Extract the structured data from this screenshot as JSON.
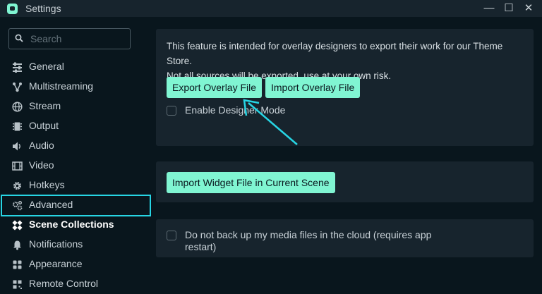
{
  "window": {
    "title": "Settings",
    "minimize": "—",
    "maximize": "☐",
    "close": "✕"
  },
  "search": {
    "placeholder": "Search"
  },
  "sidebar": {
    "items": [
      {
        "label": "General",
        "icon": "sliders-icon"
      },
      {
        "label": "Multistreaming",
        "icon": "network-icon"
      },
      {
        "label": "Stream",
        "icon": "globe-icon"
      },
      {
        "label": "Output",
        "icon": "chip-icon"
      },
      {
        "label": "Audio",
        "icon": "speaker-icon"
      },
      {
        "label": "Video",
        "icon": "film-icon"
      },
      {
        "label": "Hotkeys",
        "icon": "gear-icon"
      },
      {
        "label": "Advanced",
        "icon": "gears-icon"
      },
      {
        "label": "Scene Collections",
        "icon": "puzzle-icon",
        "active": true
      },
      {
        "label": "Notifications",
        "icon": "bell-icon"
      },
      {
        "label": "Appearance",
        "icon": "palette-icon"
      },
      {
        "label": "Remote Control",
        "icon": "remote-icon"
      }
    ]
  },
  "overlay_section": {
    "description_line1": "This feature is intended for overlay designers to export their work for our Theme Store.",
    "description_line2": "Not all sources will be exported, use at your own risk.",
    "export_button": "Export Overlay File",
    "import_button": "Import Overlay File",
    "designer_mode_label": "Enable Designer Mode",
    "designer_mode_checked": false
  },
  "widget_section": {
    "import_widget_button": "Import Widget File in Current Scene"
  },
  "backup_section": {
    "label_line1": "Do not back up my media files in the cloud (requires app",
    "label_line2": "restart)",
    "checked": false
  },
  "colors": {
    "accent": "#80f5d2",
    "highlight": "#27d5e4",
    "background": "#09161d",
    "card": "#17242d"
  }
}
